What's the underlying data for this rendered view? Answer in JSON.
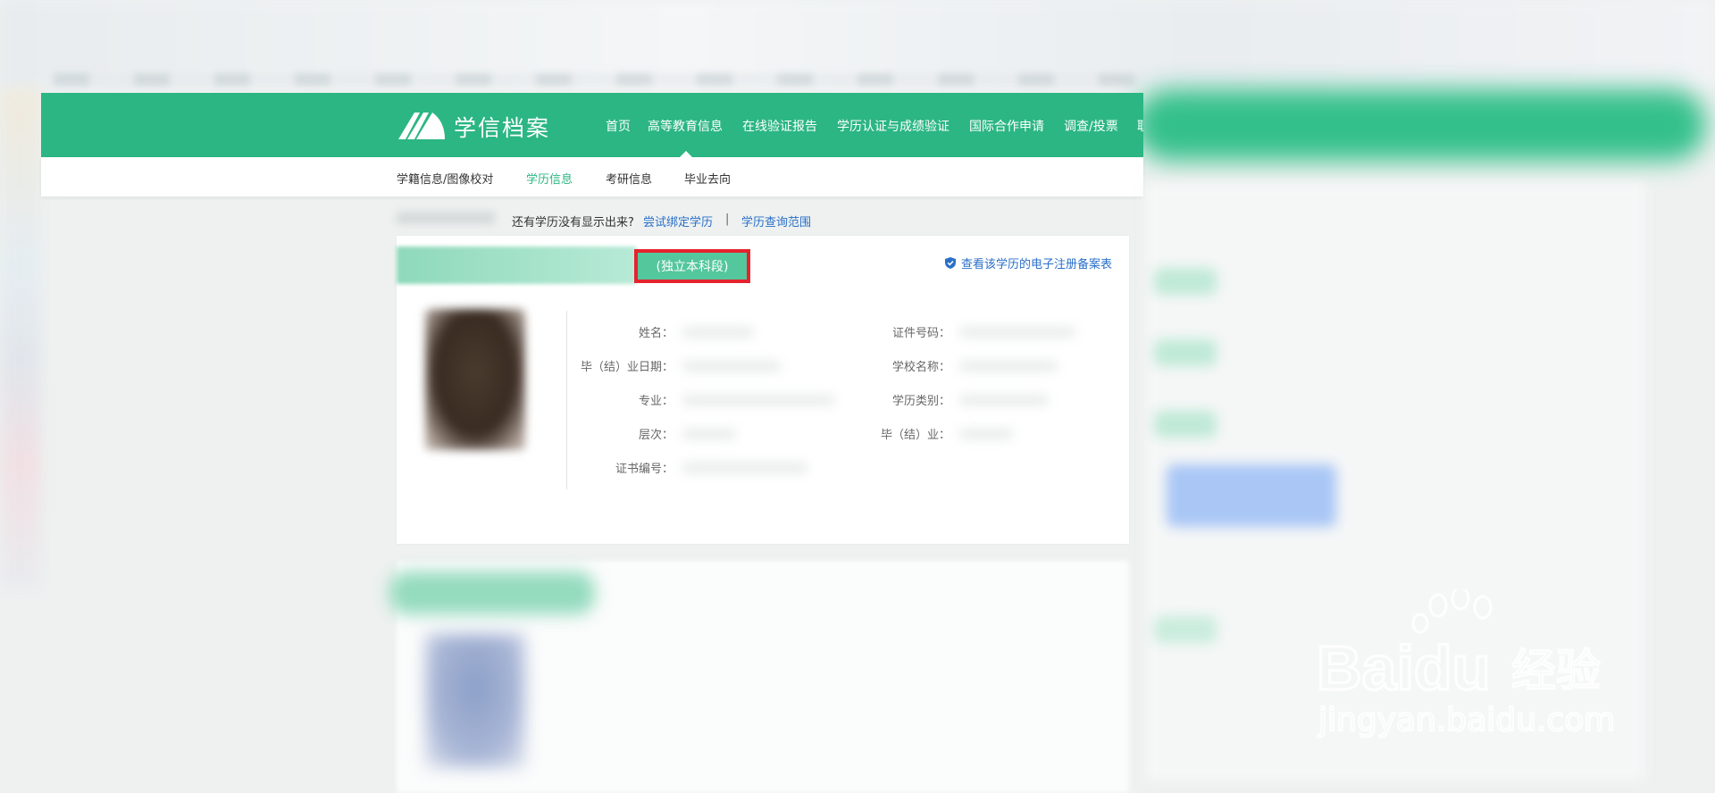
{
  "brand": {
    "name": "学信档案"
  },
  "nav": {
    "items": [
      "首页",
      "高等教育信息",
      "在线验证报告",
      "学历认证与成绩验证",
      "国际合作申请",
      "调查/投票",
      "职"
    ],
    "active": "高等教育信息"
  },
  "subnav": {
    "items": [
      "学籍信息/图像校对",
      "学历信息",
      "考研信息",
      "毕业去向"
    ],
    "active": "学历信息"
  },
  "breadcrumb": {
    "question": "还有学历没有显示出来?",
    "bind_link": "尝试绑定学历",
    "separator": "|",
    "range_link": "学历查询范围"
  },
  "card": {
    "edu_type": "(独立本科段)",
    "register_link": "查看该学历的电子注册备案表",
    "fields_left": [
      "姓名：",
      "毕（结）业日期：",
      "专业：",
      "层次：",
      "证书编号："
    ],
    "fields_right": [
      "证件号码：",
      "学校名称：",
      "学历类别：",
      "毕（结）业："
    ]
  },
  "watermark": {
    "brand": "Baidu",
    "brand_cn": "经验",
    "url": "jingyan.baidu.com"
  },
  "colors": {
    "primary": "#2bb683",
    "highlight_border": "#e5232e",
    "link": "#2a6fc8"
  }
}
